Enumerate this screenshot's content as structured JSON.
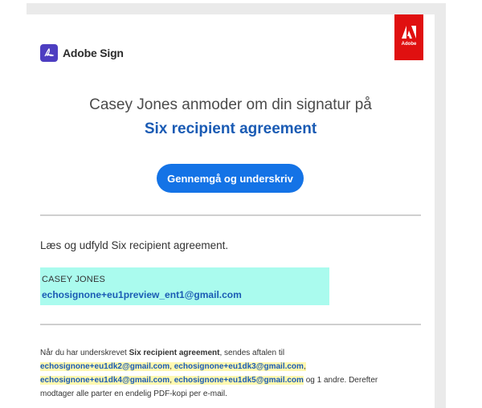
{
  "brand": {
    "name": "Adobe Sign",
    "badge_text": "Adobe"
  },
  "headline": "Casey Jones anmoder om din signatur på",
  "agreement_title": "Six recipient agreement",
  "cta_label": "Gennemgå og underskriv",
  "instruction": "Læs og udfyld Six recipient agreement.",
  "sender": {
    "name": "CASEY JONES",
    "email": "echosignone+eu1preview_ent1@gmail.com"
  },
  "info": {
    "prefix": "Når du har underskrevet ",
    "agreement": "Six recipient agreement",
    "after_agreement": ", sendes aftalen til",
    "emails": [
      "echosignone+eu1dk2@gmail.com",
      "echosignone+eu1dk3@gmail.com",
      "echosignone+eu1dk4@gmail.com",
      "echosignone+eu1dk5@gmail.com"
    ],
    "sep": ", ",
    "sep_last": ",",
    "tail": " og 1 andre. Derefter",
    "last_line": "modtager alle parter en endelig PDF-kopi per e-mail."
  },
  "colors": {
    "accent": "#1473e6",
    "title_blue": "#1a5bb4",
    "adobe_red": "#e01010",
    "sender_highlight": "#aafbee",
    "recipient_highlight": "#fff8b0"
  }
}
